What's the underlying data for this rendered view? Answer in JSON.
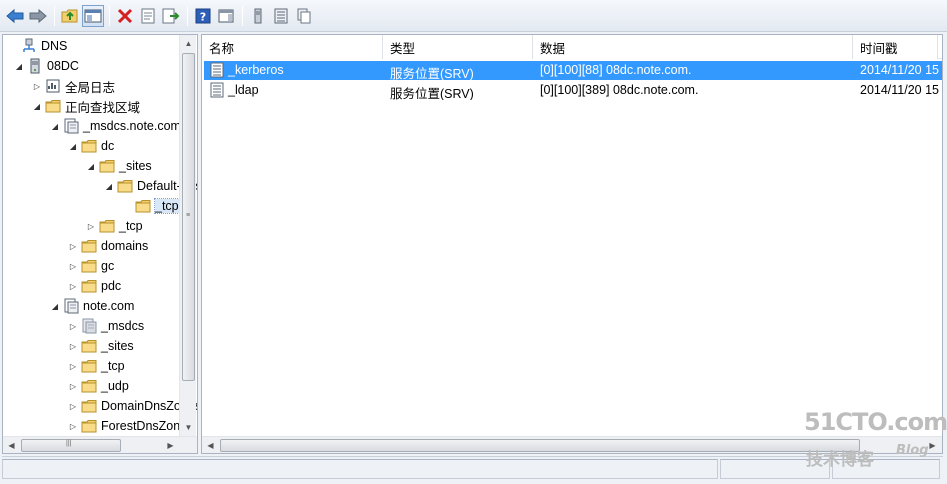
{
  "toolbar": {
    "buttons": [
      "back-arrow-icon",
      "forward-arrow-icon",
      "up-folder-icon",
      "show-hide-tree-icon",
      "delete-icon",
      "properties-icon",
      "export-list-icon",
      "help-icon",
      "action-pane-icon",
      "domain-controller-icon",
      "list-view-icon",
      "copy-icon"
    ]
  },
  "tree": {
    "items": [
      {
        "label": "DNS"
      },
      {
        "label": "08DC"
      },
      {
        "label": "全局日志"
      },
      {
        "label": "正向查找区域"
      },
      {
        "label": "_msdcs.note.com"
      },
      {
        "label": "dc"
      },
      {
        "label": "_sites"
      },
      {
        "label": "Default-First-Site-Name"
      },
      {
        "label": "_tcp"
      },
      {
        "label": "_tcp"
      },
      {
        "label": "domains"
      },
      {
        "label": "gc"
      },
      {
        "label": "pdc"
      },
      {
        "label": "note.com"
      },
      {
        "label": "_msdcs"
      },
      {
        "label": "_sites"
      },
      {
        "label": "_tcp"
      },
      {
        "label": "_udp"
      },
      {
        "label": "DomainDnsZones"
      },
      {
        "label": "ForestDnsZones"
      }
    ]
  },
  "list": {
    "columns": [
      "名称",
      "类型",
      "数据",
      "时间戳"
    ],
    "rows": [
      {
        "name": "_kerberos",
        "type": "服务位置(SRV)",
        "data": "[0][100][88] 08dc.note.com.",
        "timestamp": "2014/11/20 15"
      },
      {
        "name": "_ldap",
        "type": "服务位置(SRV)",
        "data": "[0][100][389] 08dc.note.com.",
        "timestamp": "2014/11/20 15"
      }
    ]
  },
  "watermark": {
    "brand": "51CTO.com",
    "sub": "技术博客",
    "blog": "Blog"
  },
  "colors": {
    "selection": "#3399ff",
    "folder": "#f3cf6b",
    "toolbar_bg": "#e3e9f1"
  }
}
